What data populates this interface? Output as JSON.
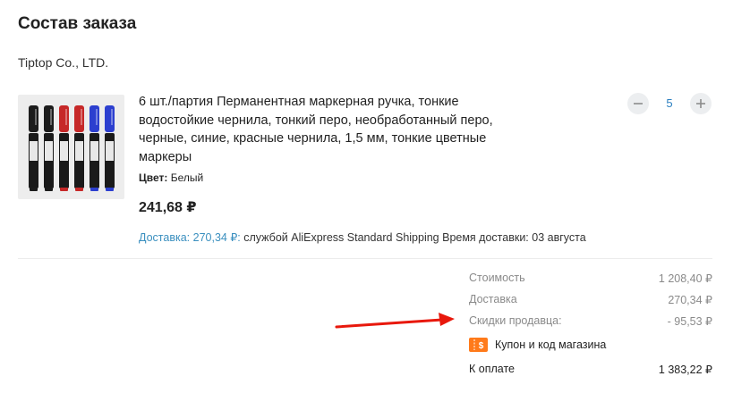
{
  "page": {
    "title": "Состав заказа",
    "seller": "Tiptop Co., LTD."
  },
  "item": {
    "name": "6 шт./партия Перманентная маркерная ручка, тонкие водостойкие чернила, тонкий перо, необработанный перо, черные, синие, красные чернила, 1,5 мм, тонкие цветные маркеры",
    "color_label": "Цвет:",
    "color_value": "Белый",
    "price": "241,68 ₽",
    "delivery_link": "Доставка: 270,34 ₽:",
    "delivery_text": "службой AliExpress Standard Shipping Время доставки: 03 августа",
    "quantity": "5",
    "marker_colors": [
      "#1c1c1c",
      "#1c1c1c",
      "#c62828",
      "#c62828",
      "#2c3fcf",
      "#2c3fcf"
    ]
  },
  "summary": {
    "rows": [
      {
        "label": "Стоимость",
        "value": "1 208,40 ₽"
      },
      {
        "label": "Доставка",
        "value": "270,34 ₽"
      },
      {
        "label": "Скидки продавца:",
        "value": "- 95,53 ₽"
      }
    ],
    "coupon_label": "Купон и код магазина",
    "total_label": "К оплате",
    "total_value": "1 383,22 ₽"
  },
  "colors": {
    "accent_blue": "#2b7fc0",
    "annotation_red": "#e8180c",
    "coupon_orange": "#ff7a1a"
  }
}
